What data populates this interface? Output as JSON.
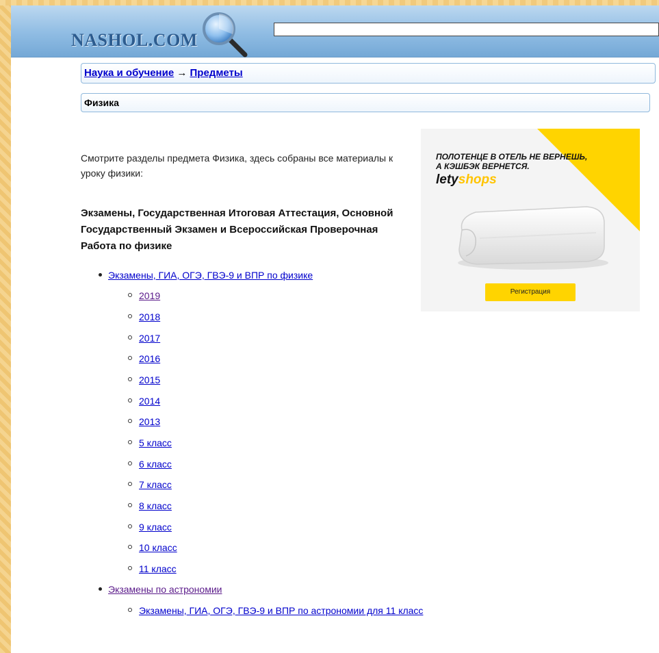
{
  "header": {
    "logo": "NASHOL.COM",
    "search_value": ""
  },
  "breadcrumb": {
    "parent": "Наука и обучение",
    "separator": "→",
    "current": "Предметы"
  },
  "page_title": "Физика",
  "intro_text": "Смотрите разделы предмета Физика, здесь собраны все материалы к уроку физики:",
  "exams_heading": "Экзамены, Государственная Итоговая Аттестация, Основной Государственный Экзамен и Всероссийская Проверочная Работа по физике",
  "physics_exams": {
    "label": "Экзамены, ГИА, ОГЭ, ГВЭ-9 и ВПР по физике",
    "items": [
      "2019",
      "2018",
      "2017",
      "2016",
      "2015",
      "2014",
      "2013",
      "5 класс",
      "6 класс",
      "7 класс",
      "8 класс",
      "9 класс",
      "10 класс",
      "11 класс"
    ]
  },
  "astronomy_exams": {
    "label": "Экзамены по астрономии",
    "items": [
      "Экзамены, ГИА, ОГЭ, ГВЭ-9 и ВПР по астрономии для 11 класс"
    ]
  },
  "ad": {
    "line1_a": "ПОЛОТЕНЦЕ В ОТЕЛЬ ",
    "line1_b": "НЕ ВЕРНЕШЬ,",
    "line2": "А КЭШБЭК ВЕРНЕТСЯ.",
    "brand_a": "lety",
    "brand_b": "shops",
    "button": "Регистрация"
  },
  "colors": {
    "link": "#0000cc",
    "visited_link": "#5a1a8a",
    "header_blue": "#8fbce3",
    "frame": "#f2cc7e",
    "ad_yellow": "#ffd400"
  }
}
